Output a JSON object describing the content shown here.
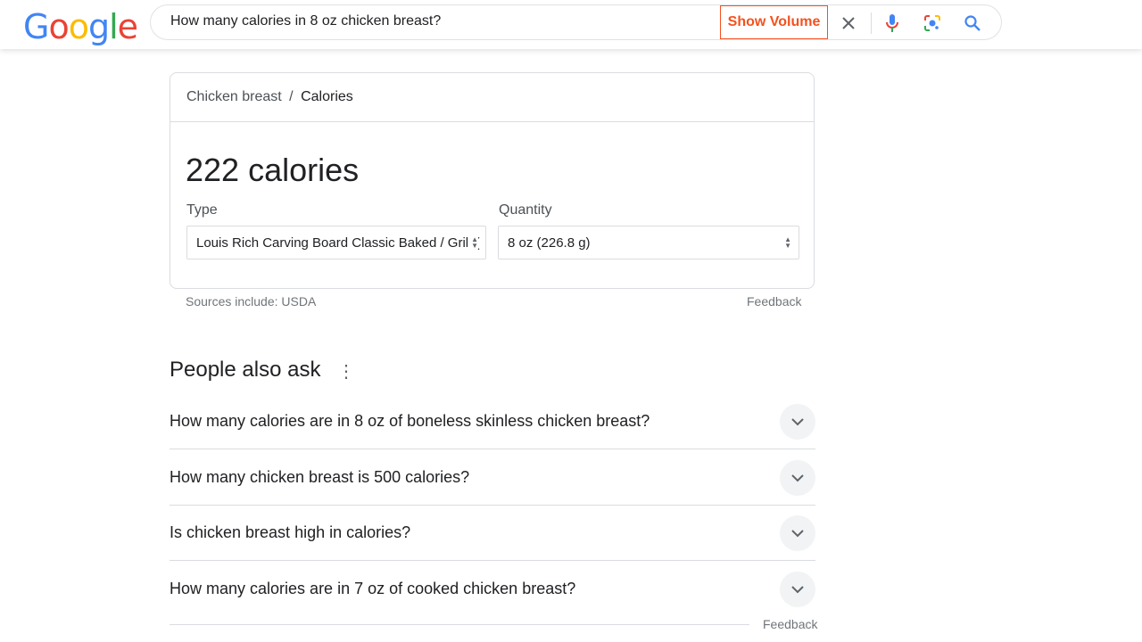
{
  "header": {
    "logo": "Google",
    "search_value": "How many calories in 8 oz chicken breast?",
    "show_volume": "Show Volume"
  },
  "card": {
    "breadcrumb_parent": "Chicken breast",
    "breadcrumb_sep": "/",
    "breadcrumb_current": "Calories",
    "calories": "222 calories",
    "type_label": "Type",
    "type_value": "Louis Rich Carving Board Classic Baked / Grill (",
    "quantity_label": "Quantity",
    "quantity_value": "8 oz (226.8 g)",
    "sources": "Sources include: USDA",
    "feedback": "Feedback"
  },
  "paa": {
    "title": "People also ask",
    "questions": [
      "How many calories are in 8 oz of boneless skinless chicken breast?",
      "How many chicken breast is 500 calories?",
      "Is chicken breast high in calories?",
      "How many calories are in 7 oz of cooked chicken breast?"
    ],
    "feedback": "Feedback"
  },
  "colors": {
    "accent": "#f4511e",
    "link_blue": "#4285f4"
  }
}
